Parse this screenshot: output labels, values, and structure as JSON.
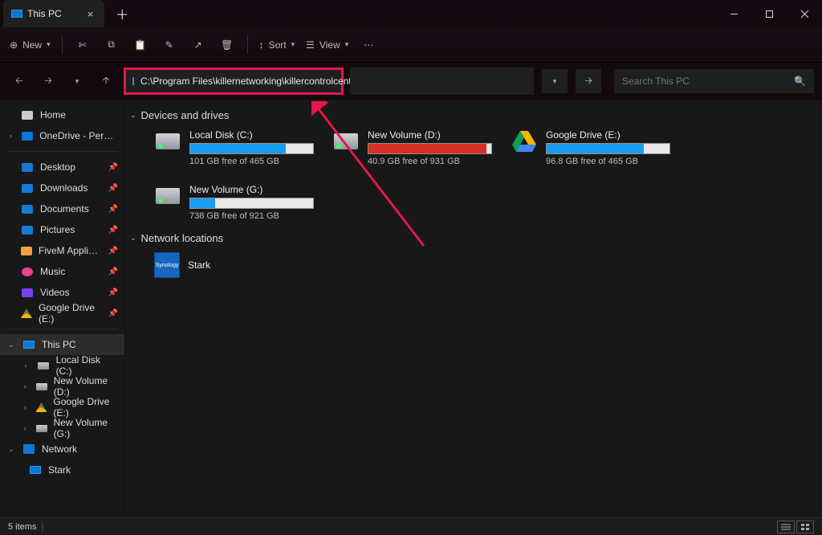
{
  "window": {
    "tab_title": "This PC"
  },
  "toolbar": {
    "new_label": "New",
    "sort_label": "Sort",
    "view_label": "View"
  },
  "address": {
    "path": "C:\\Program Files\\killernetworking\\killercontrolcenter"
  },
  "search": {
    "placeholder": "Search This PC"
  },
  "sidebar": {
    "home": "Home",
    "onedrive": "OneDrive - Personal",
    "quick": [
      {
        "label": "Desktop"
      },
      {
        "label": "Downloads"
      },
      {
        "label": "Documents"
      },
      {
        "label": "Pictures"
      },
      {
        "label": "FiveM Application"
      },
      {
        "label": "Music"
      },
      {
        "label": "Videos"
      },
      {
        "label": "Google Drive (E:)"
      }
    ],
    "thispc": "This PC",
    "drives": [
      {
        "label": "Local Disk (C:)"
      },
      {
        "label": "New Volume (D:)"
      },
      {
        "label": "Google Drive (E:)"
      },
      {
        "label": "New Volume (G:)"
      }
    ],
    "network": "Network",
    "network_items": [
      {
        "label": "Stark"
      }
    ]
  },
  "sections": {
    "devices": "Devices and drives",
    "network": "Network locations"
  },
  "drives": [
    {
      "name": "Local Disk (C:)",
      "sub": "101 GB free of 465 GB",
      "fill_pct": 78,
      "color": "blue",
      "icon": "disk"
    },
    {
      "name": "New Volume (D:)",
      "sub": "40.9 GB free of 931 GB",
      "fill_pct": 96,
      "color": "red",
      "icon": "disk"
    },
    {
      "name": "Google Drive (E:)",
      "sub": "96.8 GB free of 465 GB",
      "fill_pct": 79,
      "color": "blue",
      "icon": "gdrive"
    },
    {
      "name": "New Volume (G:)",
      "sub": "738 GB free of 921 GB",
      "fill_pct": 20,
      "color": "blue",
      "icon": "disk"
    }
  ],
  "network_locations": [
    {
      "name": "Stark"
    }
  ],
  "status": {
    "items": "5 items"
  }
}
